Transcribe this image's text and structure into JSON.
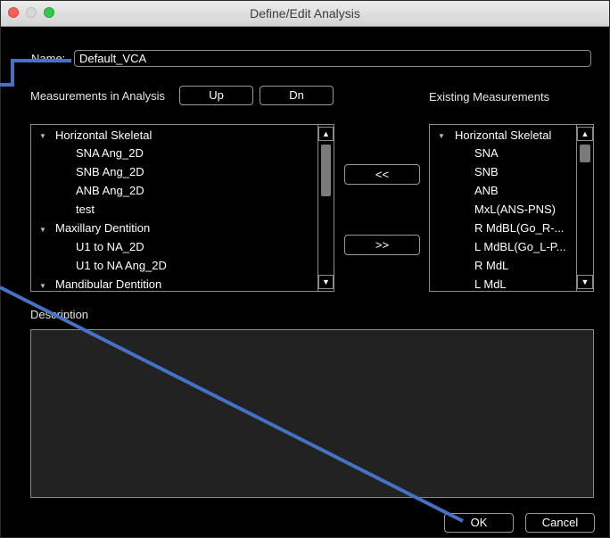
{
  "window": {
    "title": "Define/Edit Analysis"
  },
  "name_field": {
    "label": "Name:",
    "value": "Default_VCA"
  },
  "left_panel": {
    "title": "Measurements in Analysis",
    "up_label": "Up",
    "dn_label": "Dn",
    "items": [
      "Horizontal Skeletal",
      "SNA Ang_2D",
      "SNB Ang_2D",
      "ANB Ang_2D",
      "test",
      "Maxillary Dentition",
      "U1 to NA_2D",
      "U1 to NA Ang_2D",
      "Mandibular Dentition"
    ]
  },
  "middle": {
    "add_label": "<<",
    "remove_label": ">>"
  },
  "right_panel": {
    "title": "Existing Measurements",
    "items": [
      "Horizontal Skeletal",
      "SNA",
      "SNB",
      "ANB",
      "MxL(ANS-PNS)",
      "R MdBL(Go_R-...",
      "L MdBL(Go_L-P...",
      "R MdL",
      "L MdL"
    ]
  },
  "description": {
    "label": "Description"
  },
  "footer": {
    "ok_label": "OK",
    "cancel_label": "Cancel"
  },
  "icons": {
    "expand": "triangle-down-icon",
    "scroll_up": "arrow-up-icon",
    "scroll_down": "arrow-down-icon"
  },
  "colors": {
    "annotation_line": "#4472c4",
    "close": "#fc605c",
    "zoom": "#34c84a"
  }
}
